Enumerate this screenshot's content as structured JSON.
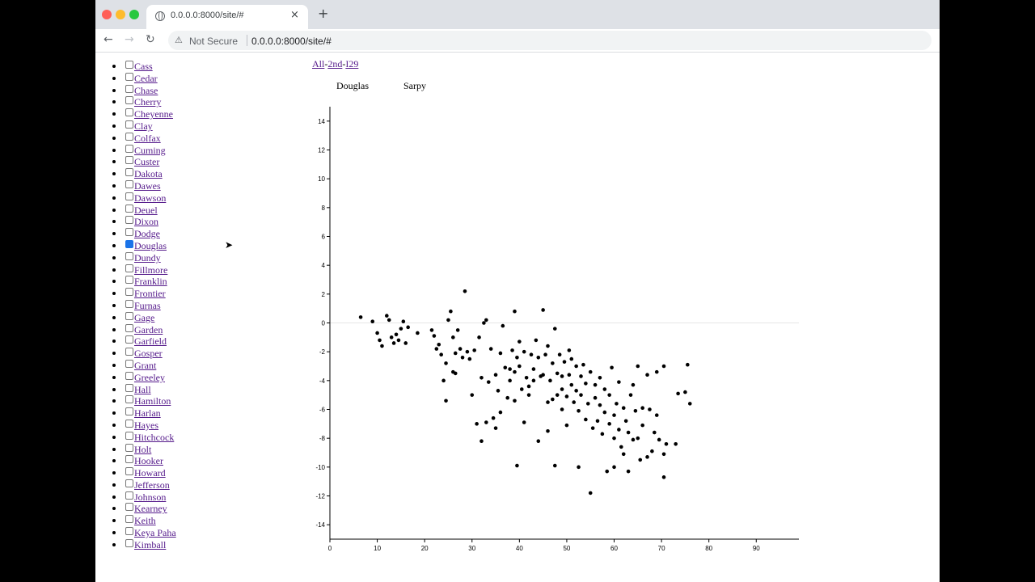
{
  "browser": {
    "tab_title": "0.0.0.0:8000/site/#",
    "tab_close": "×",
    "new_tab": "+",
    "back": "←",
    "forward": "→",
    "reload": "↻",
    "warning_icon": "⚠",
    "not_secure": "Not Secure",
    "url": "0.0.0.0:8000/site/#"
  },
  "filters": {
    "all": "All",
    "second": "2nd",
    "i29": "I29"
  },
  "selected": [
    "Douglas",
    "Sarpy"
  ],
  "counties": [
    {
      "name": "Cass",
      "checked": false
    },
    {
      "name": "Cedar",
      "checked": false
    },
    {
      "name": "Chase",
      "checked": false
    },
    {
      "name": "Cherry",
      "checked": false
    },
    {
      "name": "Cheyenne",
      "checked": false
    },
    {
      "name": "Clay",
      "checked": false
    },
    {
      "name": "Colfax",
      "checked": false
    },
    {
      "name": "Cuming",
      "checked": false
    },
    {
      "name": "Custer",
      "checked": false
    },
    {
      "name": "Dakota",
      "checked": false
    },
    {
      "name": "Dawes",
      "checked": false
    },
    {
      "name": "Dawson",
      "checked": false
    },
    {
      "name": "Deuel",
      "checked": false
    },
    {
      "name": "Dixon",
      "checked": false
    },
    {
      "name": "Dodge",
      "checked": false
    },
    {
      "name": "Douglas",
      "checked": true
    },
    {
      "name": "Dundy",
      "checked": false
    },
    {
      "name": "Fillmore",
      "checked": false
    },
    {
      "name": "Franklin",
      "checked": false
    },
    {
      "name": "Frontier",
      "checked": false
    },
    {
      "name": "Furnas",
      "checked": false
    },
    {
      "name": "Gage",
      "checked": false
    },
    {
      "name": "Garden",
      "checked": false
    },
    {
      "name": "Garfield",
      "checked": false
    },
    {
      "name": "Gosper",
      "checked": false
    },
    {
      "name": "Grant",
      "checked": false
    },
    {
      "name": "Greeley",
      "checked": false
    },
    {
      "name": "Hall",
      "checked": false
    },
    {
      "name": "Hamilton",
      "checked": false
    },
    {
      "name": "Harlan",
      "checked": false
    },
    {
      "name": "Hayes",
      "checked": false
    },
    {
      "name": "Hitchcock",
      "checked": false
    },
    {
      "name": "Holt",
      "checked": false
    },
    {
      "name": "Hooker",
      "checked": false
    },
    {
      "name": "Howard",
      "checked": false
    },
    {
      "name": "Jefferson",
      "checked": false
    },
    {
      "name": "Johnson",
      "checked": false
    },
    {
      "name": "Kearney",
      "checked": false
    },
    {
      "name": "Keith",
      "checked": false
    },
    {
      "name": "Keya Paha",
      "checked": false
    },
    {
      "name": "Kimball",
      "checked": false
    }
  ],
  "chart_data": {
    "type": "scatter",
    "title": "",
    "xlabel": "",
    "ylabel": "",
    "xlim": [
      0,
      99
    ],
    "ylim": [
      -15,
      15
    ],
    "x_ticks": [
      0,
      10,
      20,
      30,
      40,
      50,
      60,
      70,
      80,
      90
    ],
    "y_ticks": [
      -14,
      -12,
      -10,
      -8,
      -6,
      -4,
      -2,
      0,
      2,
      4,
      6,
      8,
      10,
      12,
      14
    ],
    "zero_line": true,
    "points": [
      [
        6.5,
        0.4
      ],
      [
        9,
        0.1
      ],
      [
        10,
        -0.7
      ],
      [
        10.5,
        -1.2
      ],
      [
        11,
        -1.6
      ],
      [
        12,
        0.5
      ],
      [
        12.5,
        0.2
      ],
      [
        13,
        -1.0
      ],
      [
        13.5,
        -1.4
      ],
      [
        14,
        -0.8
      ],
      [
        14.5,
        -1.2
      ],
      [
        15,
        -0.4
      ],
      [
        15.5,
        0.1
      ],
      [
        16,
        -1.4
      ],
      [
        16.5,
        -0.3
      ],
      [
        18.5,
        -0.7
      ],
      [
        21.5,
        -0.5
      ],
      [
        22,
        -0.9
      ],
      [
        22.5,
        -1.8
      ],
      [
        23,
        -1.5
      ],
      [
        23.5,
        -2.2
      ],
      [
        24,
        -4.0
      ],
      [
        24.5,
        -5.4
      ],
      [
        24.5,
        -2.8
      ],
      [
        25,
        0.2
      ],
      [
        25.5,
        0.8
      ],
      [
        26,
        -3.4
      ],
      [
        26,
        -1.0
      ],
      [
        26.5,
        -3.5
      ],
      [
        26.5,
        -2.1
      ],
      [
        27,
        -0.5
      ],
      [
        27.5,
        -1.8
      ],
      [
        28,
        -2.4
      ],
      [
        28.5,
        2.2
      ],
      [
        29,
        -2.0
      ],
      [
        29.5,
        -2.5
      ],
      [
        30,
        -5.0
      ],
      [
        30.5,
        -1.9
      ],
      [
        31,
        -7.0
      ],
      [
        31.5,
        -1.0
      ],
      [
        32,
        -8.2
      ],
      [
        32,
        -3.8
      ],
      [
        32.5,
        0.0
      ],
      [
        33,
        0.2
      ],
      [
        33,
        -6.9
      ],
      [
        33.5,
        -4.1
      ],
      [
        34,
        -1.8
      ],
      [
        34.5,
        -6.6
      ],
      [
        35,
        -3.6
      ],
      [
        35,
        -7.3
      ],
      [
        35.5,
        -4.7
      ],
      [
        36,
        -6.2
      ],
      [
        36,
        -2.1
      ],
      [
        36.5,
        -0.2
      ],
      [
        37,
        -3.1
      ],
      [
        37.5,
        -5.2
      ],
      [
        38,
        -4.0
      ],
      [
        38,
        -3.2
      ],
      [
        38.5,
        -1.9
      ],
      [
        39,
        0.8
      ],
      [
        39,
        -3.4
      ],
      [
        39,
        -5.4
      ],
      [
        39.5,
        -9.9
      ],
      [
        39.5,
        -2.4
      ],
      [
        40,
        -3.0
      ],
      [
        40,
        -1.3
      ],
      [
        40.5,
        -4.6
      ],
      [
        41,
        -6.9
      ],
      [
        41,
        -2.0
      ],
      [
        41.5,
        -3.8
      ],
      [
        42,
        -4.4
      ],
      [
        42,
        -5.0
      ],
      [
        42.5,
        -2.2
      ],
      [
        43,
        -4.0
      ],
      [
        43,
        -3.2
      ],
      [
        43.5,
        -1.2
      ],
      [
        44,
        -8.2
      ],
      [
        44,
        -2.4
      ],
      [
        44.5,
        -3.7
      ],
      [
        45,
        0.9
      ],
      [
        45,
        -3.6
      ],
      [
        45.5,
        -2.2
      ],
      [
        46,
        -5.5
      ],
      [
        46,
        -1.6
      ],
      [
        46,
        -7.5
      ],
      [
        46.5,
        -4.0
      ],
      [
        47,
        -2.8
      ],
      [
        47,
        -5.3
      ],
      [
        47.5,
        -9.9
      ],
      [
        47.5,
        -0.4
      ],
      [
        48,
        -3.5
      ],
      [
        48,
        -5.0
      ],
      [
        48.5,
        -2.2
      ],
      [
        49,
        -3.7
      ],
      [
        49,
        -4.6
      ],
      [
        49,
        -6.0
      ],
      [
        49.5,
        -2.7
      ],
      [
        50,
        -5.1
      ],
      [
        50,
        -7.1
      ],
      [
        50.5,
        -1.9
      ],
      [
        50.5,
        -3.6
      ],
      [
        51,
        -4.3
      ],
      [
        51,
        -2.5
      ],
      [
        51.5,
        -5.5
      ],
      [
        52,
        -3.0
      ],
      [
        52,
        -4.7
      ],
      [
        52.5,
        -6.1
      ],
      [
        52.5,
        -10.0
      ],
      [
        53,
        -3.7
      ],
      [
        53,
        -5.0
      ],
      [
        53.5,
        -2.9
      ],
      [
        54,
        -4.2
      ],
      [
        54,
        -6.7
      ],
      [
        54.5,
        -5.6
      ],
      [
        55,
        -3.4
      ],
      [
        55,
        -11.8
      ],
      [
        55.5,
        -7.3
      ],
      [
        56,
        -4.3
      ],
      [
        56,
        -5.2
      ],
      [
        56.5,
        -6.8
      ],
      [
        57,
        -3.8
      ],
      [
        57,
        -5.7
      ],
      [
        57.5,
        -7.7
      ],
      [
        58,
        -4.6
      ],
      [
        58,
        -6.2
      ],
      [
        58.5,
        -10.3
      ],
      [
        59,
        -5.0
      ],
      [
        59,
        -7.0
      ],
      [
        59.5,
        -3.1
      ],
      [
        60,
        -6.4
      ],
      [
        60,
        -8.0
      ],
      [
        60,
        -10.0
      ],
      [
        60.5,
        -5.6
      ],
      [
        61,
        -7.4
      ],
      [
        61,
        -4.1
      ],
      [
        61.5,
        -8.6
      ],
      [
        62,
        -5.9
      ],
      [
        62,
        -9.1
      ],
      [
        62.5,
        -6.8
      ],
      [
        63,
        -10.3
      ],
      [
        63,
        -7.6
      ],
      [
        63.5,
        -5.0
      ],
      [
        64,
        -8.1
      ],
      [
        64,
        -4.3
      ],
      [
        64.5,
        -6.1
      ],
      [
        65,
        -8.0
      ],
      [
        65,
        -3.0
      ],
      [
        65.5,
        -9.5
      ],
      [
        66,
        -5.9
      ],
      [
        66,
        -7.1
      ],
      [
        67,
        -9.3
      ],
      [
        67,
        -3.6
      ],
      [
        67.5,
        -6.0
      ],
      [
        68,
        -8.9
      ],
      [
        68.5,
        -7.6
      ],
      [
        69,
        -3.4
      ],
      [
        69,
        -6.4
      ],
      [
        69.5,
        -8.1
      ],
      [
        70.5,
        -3.0
      ],
      [
        70.5,
        -9.1
      ],
      [
        70.5,
        -10.7
      ],
      [
        71,
        -8.4
      ],
      [
        73,
        -8.4
      ],
      [
        73.5,
        -4.9
      ],
      [
        75,
        -4.8
      ],
      [
        75.5,
        -2.9
      ],
      [
        76,
        -5.6
      ]
    ]
  }
}
